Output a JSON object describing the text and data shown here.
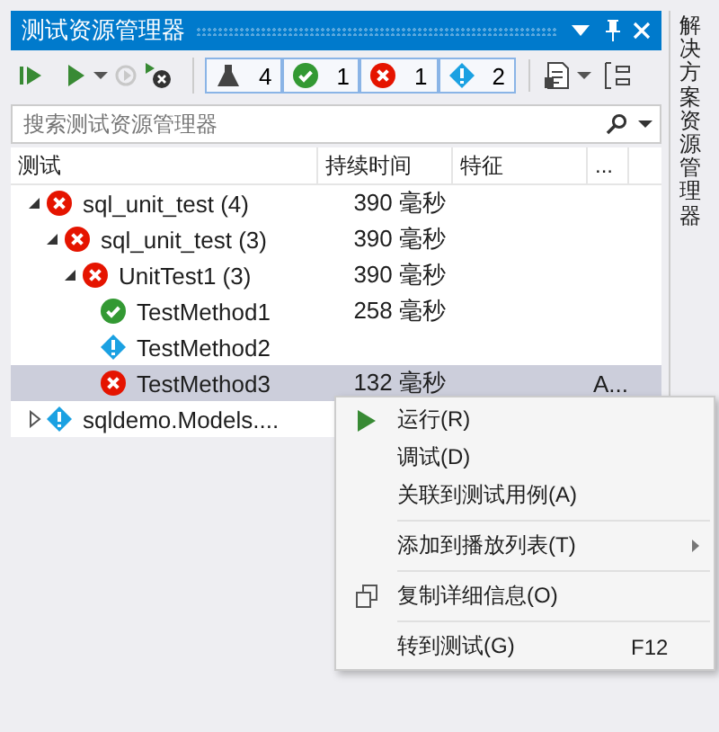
{
  "window": {
    "title": "测试资源管理器"
  },
  "side_tab": {
    "label": "解决方案资源管理器"
  },
  "toolbar": {
    "filters": [
      {
        "kind": "all",
        "count": "4"
      },
      {
        "kind": "passed",
        "count": "1"
      },
      {
        "kind": "failed",
        "count": "1"
      },
      {
        "kind": "notrun",
        "count": "2"
      }
    ],
    "rerun_disabled": true
  },
  "search": {
    "placeholder": "搜索测试资源管理器"
  },
  "table": {
    "columns": [
      "测试",
      "持续时间",
      "特征",
      "..."
    ],
    "rows": [
      {
        "name": "sql_unit_test (4)",
        "kind": "failed",
        "duration": "390 毫秒",
        "expanded": true,
        "selected": false,
        "children": [
          {
            "name": "sql_unit_test (3)",
            "kind": "failed",
            "duration": "390 毫秒",
            "expanded": true,
            "selected": false,
            "children": [
              {
                "name": "UnitTest1 (3)",
                "kind": "failed",
                "duration": "390 毫秒",
                "expanded": true,
                "selected": false,
                "children": [
                  {
                    "name": "TestMethod1",
                    "kind": "passed",
                    "duration": "258 毫秒",
                    "selected": false
                  },
                  {
                    "name": "TestMethod2",
                    "kind": "notrun",
                    "selected": false
                  },
                  {
                    "name": "TestMethod3",
                    "kind": "failed",
                    "duration": "132 毫秒",
                    "column_4": "A...",
                    "selected": true
                  }
                ]
              }
            ]
          }
        ]
      },
      {
        "name": "sqldemo.Models....",
        "kind": "notrun",
        "expanded": false,
        "selected": false
      }
    ]
  },
  "context_menu": [
    {
      "kind": "play",
      "label": "运行(R)"
    },
    {
      "kind": "item",
      "label": "调试(D)"
    },
    {
      "kind": "item",
      "label": "关联到测试用例(A)"
    },
    {
      "kind": "separator"
    },
    {
      "kind": "item",
      "label": "添加到播放列表(T)",
      "submenu": true
    },
    {
      "kind": "separator"
    },
    {
      "kind": "copy",
      "label": "复制详细信息(O)"
    },
    {
      "kind": "separator"
    },
    {
      "kind": "item",
      "label": "转到测试(G)",
      "shortcut": "F12"
    }
  ]
}
